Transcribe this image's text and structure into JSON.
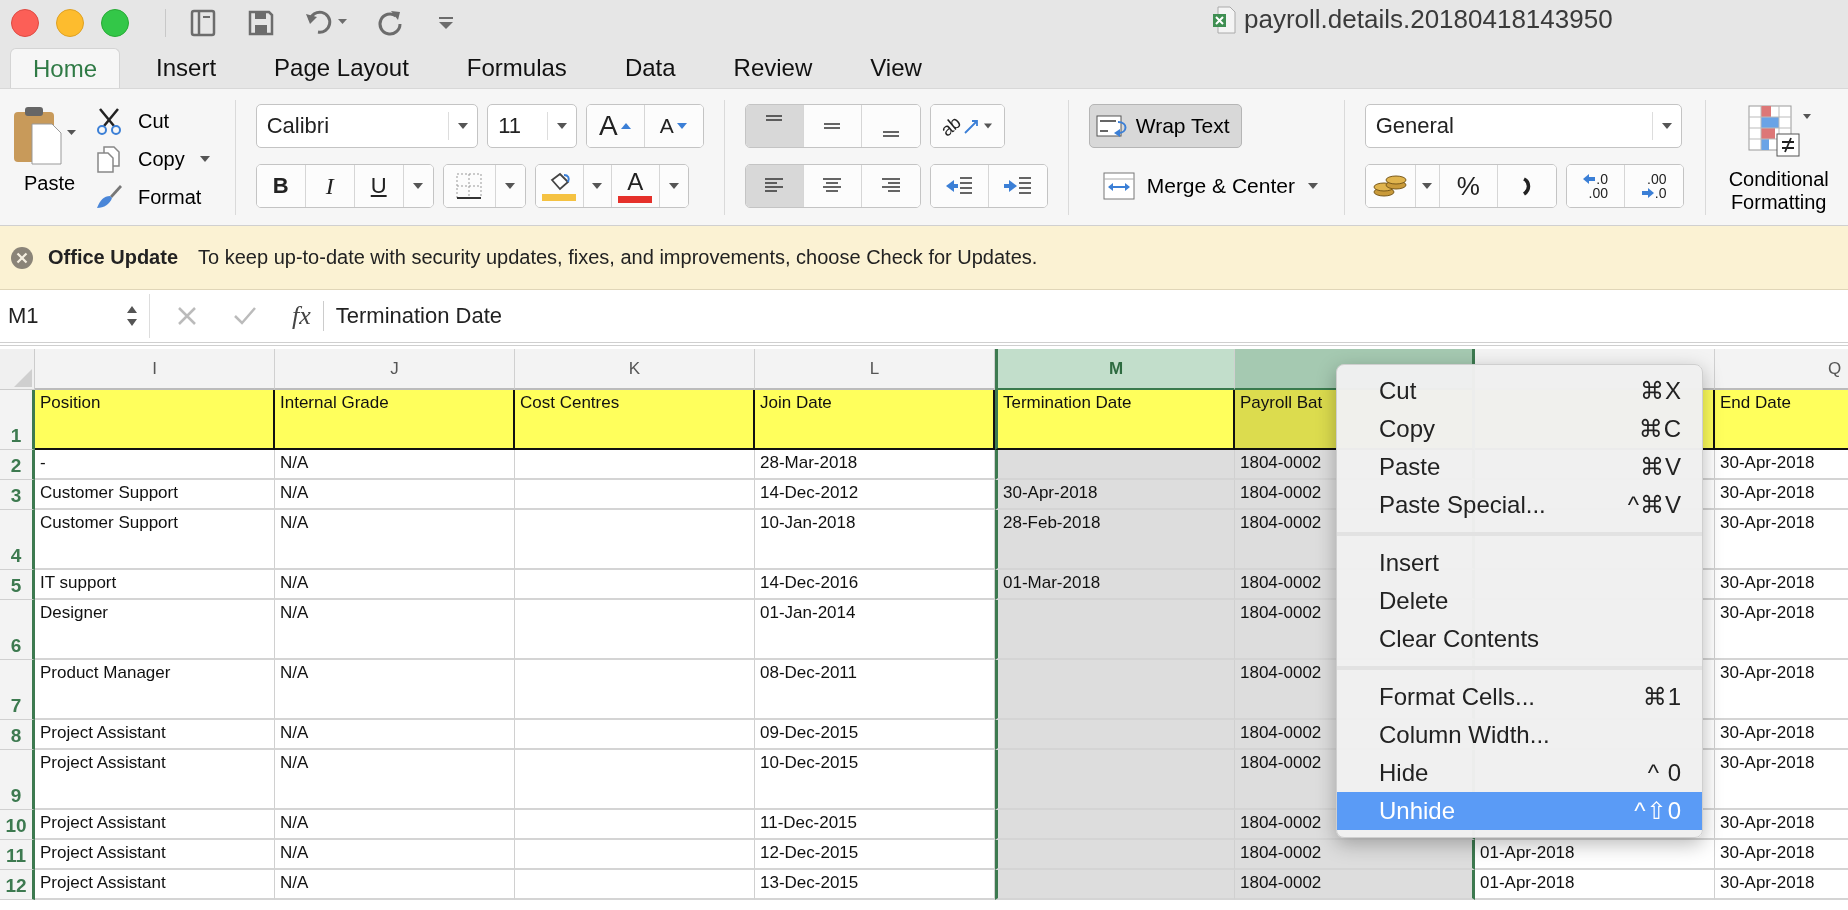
{
  "window": {
    "title": "payroll.details.20180418143950"
  },
  "tabs": [
    {
      "label": "Home",
      "selected": true
    },
    {
      "label": "Insert",
      "selected": false
    },
    {
      "label": "Page Layout",
      "selected": false
    },
    {
      "label": "Formulas",
      "selected": false
    },
    {
      "label": "Data",
      "selected": false
    },
    {
      "label": "Review",
      "selected": false
    },
    {
      "label": "View",
      "selected": false
    }
  ],
  "ribbon": {
    "clipboard": {
      "paste": "Paste",
      "cut": "Cut",
      "copy": "Copy",
      "format": "Format"
    },
    "font": {
      "name": "Calibri",
      "size": "11"
    },
    "size_buttons": [
      {
        "kind": "grow",
        "glyph": "A"
      },
      {
        "kind": "shrink",
        "glyph": "A"
      }
    ],
    "style_buttons": [
      {
        "kind": "bold",
        "glyph": "B"
      },
      {
        "kind": "italic",
        "glyph": "I"
      },
      {
        "kind": "underline",
        "glyph": "U"
      }
    ],
    "color_buttons": [
      {
        "kind": "fill",
        "color": "#f5c242"
      },
      {
        "kind": "font",
        "glyph": "A",
        "color": "#e5302a"
      }
    ],
    "vertical_align": [
      {
        "kind": "top",
        "selected": true
      },
      {
        "kind": "middle",
        "selected": false
      },
      {
        "kind": "bottom",
        "selected": false
      }
    ],
    "horizontal_align": [
      {
        "kind": "left",
        "selected": true
      },
      {
        "kind": "center",
        "selected": false
      },
      {
        "kind": "right",
        "selected": false
      }
    ],
    "orientation": "ab",
    "wrap_text": {
      "label": "Wrap Text",
      "on": true
    },
    "merge": "Merge & Center",
    "number_format": "General",
    "percent": "%",
    "decimals": [
      {
        "kind": "increase",
        "top": ".0",
        "bottom": ".00"
      },
      {
        "kind": "decrease",
        "top": ".00",
        "bottom": ".0"
      }
    ],
    "conditional_formatting": "Conditional Formatting"
  },
  "notification": {
    "title": "Office Update",
    "message": "To keep up-to-date with security updates, fixes, and improvements, choose Check for Updates."
  },
  "formula_bar": {
    "name_box": "M1",
    "function_label": "fx",
    "formula": "Termination Date"
  },
  "sheet": {
    "columns": [
      {
        "letter": "I",
        "selected": false,
        "active": false
      },
      {
        "letter": "J",
        "selected": false,
        "active": false
      },
      {
        "letter": "K",
        "selected": false,
        "active": false
      },
      {
        "letter": "L",
        "selected": false,
        "active": false
      },
      {
        "letter": "M",
        "selected": true,
        "active": true
      },
      {
        "selected": true,
        "active": false
      },
      {
        "selected": false,
        "active": false
      },
      {
        "letter": "Q",
        "selected": false,
        "active": false
      }
    ],
    "rows": [
      {
        "number": "1",
        "kind": "header",
        "tall": true,
        "cells": [
          "Position",
          "Internal Grade",
          "Cost Centres",
          "Join Date",
          "Termination Date",
          "Payroll Bat",
          "",
          "End Date"
        ]
      },
      {
        "number": "2",
        "kind": "data",
        "tall": false,
        "cells": [
          "-",
          "N/A",
          "",
          "28-Mar-2018",
          "",
          "1804-0002",
          "",
          "30-Apr-2018"
        ]
      },
      {
        "number": "3",
        "kind": "data",
        "tall": false,
        "cells": [
          "Customer Support",
          "N/A",
          "",
          "14-Dec-2012",
          "30-Apr-2018",
          "1804-0002",
          "",
          "30-Apr-2018"
        ]
      },
      {
        "number": "4",
        "kind": "data",
        "tall": true,
        "cells": [
          "Customer Support",
          "N/A",
          "",
          "10-Jan-2018",
          "28-Feb-2018",
          "1804-0002",
          "",
          "30-Apr-2018"
        ]
      },
      {
        "number": "5",
        "kind": "data",
        "tall": false,
        "cells": [
          "IT support",
          "N/A",
          "",
          "14-Dec-2016",
          "01-Mar-2018",
          "1804-0002",
          "",
          "30-Apr-2018"
        ]
      },
      {
        "number": "6",
        "kind": "data",
        "tall": true,
        "cells": [
          "Designer",
          "N/A",
          "",
          "01-Jan-2014",
          "",
          "1804-0002",
          "",
          "30-Apr-2018"
        ]
      },
      {
        "number": "7",
        "kind": "data",
        "tall": true,
        "cells": [
          "Product Manager",
          "N/A",
          "",
          "08-Dec-2011",
          "",
          "1804-0002",
          "",
          "30-Apr-2018"
        ]
      },
      {
        "number": "8",
        "kind": "data",
        "tall": false,
        "cells": [
          "Project Assistant",
          "N/A",
          "",
          "09-Dec-2015",
          "",
          "1804-0002",
          "",
          "30-Apr-2018"
        ]
      },
      {
        "number": "9",
        "kind": "data",
        "tall": true,
        "cells": [
          "Project Assistant",
          "N/A",
          "",
          "10-Dec-2015",
          "",
          "1804-0002",
          "",
          "30-Apr-2018"
        ]
      },
      {
        "number": "10",
        "kind": "data",
        "tall": false,
        "cells": [
          "Project Assistant",
          "N/A",
          "",
          "11-Dec-2015",
          "",
          "1804-0002",
          "",
          "30-Apr-2018"
        ]
      },
      {
        "number": "11",
        "kind": "data",
        "tall": false,
        "cells": [
          "Project Assistant",
          "N/A",
          "",
          "12-Dec-2015",
          "",
          "1804-0002",
          "01-Apr-2018",
          "30-Apr-2018"
        ]
      },
      {
        "number": "12",
        "kind": "data",
        "tall": false,
        "cells": [
          "Project Assistant",
          "N/A",
          "",
          "13-Dec-2015",
          "",
          "1804-0002",
          "01-Apr-2018",
          "30-Apr-2018"
        ]
      }
    ]
  },
  "context_menu": {
    "sections": [
      [
        {
          "label": "Cut",
          "shortcut": "⌘X",
          "selected": false
        },
        {
          "label": "Copy",
          "shortcut": "⌘C",
          "selected": false
        },
        {
          "label": "Paste",
          "shortcut": "⌘V",
          "selected": false
        },
        {
          "label": "Paste Special...",
          "shortcut": "^⌘V",
          "selected": false
        }
      ],
      [
        {
          "label": "Insert",
          "selected": false
        },
        {
          "label": "Delete",
          "selected": false
        },
        {
          "label": "Clear Contents",
          "selected": false
        }
      ],
      [
        {
          "label": "Format Cells...",
          "shortcut": "⌘1",
          "selected": false
        },
        {
          "label": "Column Width...",
          "selected": false
        },
        {
          "label": "Hide",
          "shortcut": "^ 0",
          "selected": false
        },
        {
          "label": "Unhide",
          "shortcut": "^⇧0",
          "selected": true
        }
      ]
    ]
  }
}
